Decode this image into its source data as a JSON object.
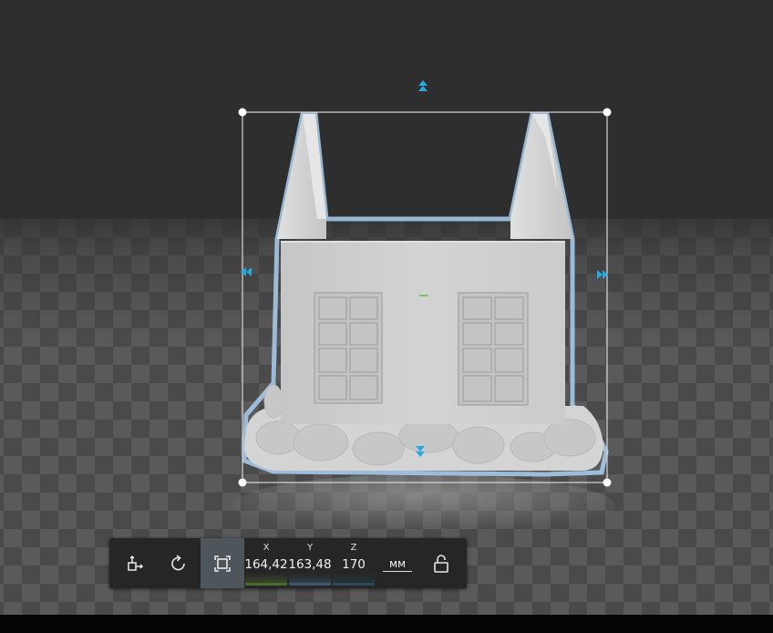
{
  "toolbar": {
    "buttons": [
      {
        "id": "move",
        "icon": "move-tool-icon",
        "active": false
      },
      {
        "id": "rotate",
        "icon": "rotate-icon",
        "active": false
      },
      {
        "id": "scale",
        "icon": "scale-icon",
        "active": true
      }
    ],
    "x": {
      "label": "X",
      "value": "164,42"
    },
    "y": {
      "label": "Y",
      "value": "163,48"
    },
    "z": {
      "label": "Z",
      "value": "170"
    },
    "unit": "мм",
    "lock_icon": "unlocked-padlock-icon"
  },
  "colors": {
    "accent": "#29a8e0",
    "selection_outline": "#a9cff0",
    "model": "#cfcfcf",
    "x_axis": "#4d6a2a",
    "y_axis": "#3b5870",
    "background": "#2e2e2e"
  }
}
